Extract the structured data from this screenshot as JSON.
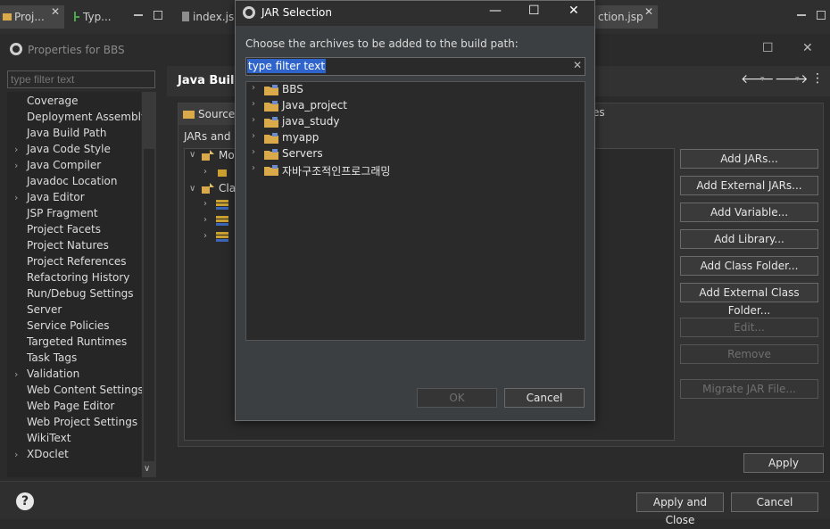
{
  "ide_tabs": {
    "tab1": "Proj...",
    "tab2": "Typ...",
    "tab3": "index.jsp",
    "tab4": "ction.jsp"
  },
  "properties": {
    "title": "Properties for BBS",
    "filter_placeholder": "type filter text",
    "tree_items": [
      {
        "label": "Coverage",
        "expandable": false
      },
      {
        "label": "Deployment Assembly",
        "expandable": false
      },
      {
        "label": "Java Build Path",
        "expandable": false
      },
      {
        "label": "Java Code Style",
        "expandable": true
      },
      {
        "label": "Java Compiler",
        "expandable": true
      },
      {
        "label": "Javadoc Location",
        "expandable": false
      },
      {
        "label": "Java Editor",
        "expandable": true
      },
      {
        "label": "JSP Fragment",
        "expandable": false
      },
      {
        "label": "Project Facets",
        "expandable": false
      },
      {
        "label": "Project Natures",
        "expandable": false
      },
      {
        "label": "Project References",
        "expandable": false
      },
      {
        "label": "Refactoring History",
        "expandable": false
      },
      {
        "label": "Run/Debug Settings",
        "expandable": false
      },
      {
        "label": "Server",
        "expandable": false
      },
      {
        "label": "Service Policies",
        "expandable": false
      },
      {
        "label": "Targeted Runtimes",
        "expandable": false
      },
      {
        "label": "Task Tags",
        "expandable": false
      },
      {
        "label": "Validation",
        "expandable": true
      },
      {
        "label": "Web Content Settings",
        "expandable": false
      },
      {
        "label": "Web Page Editor",
        "expandable": false
      },
      {
        "label": "Web Project Settings",
        "expandable": false
      },
      {
        "label": "WikiText",
        "expandable": false
      },
      {
        "label": "XDoclet",
        "expandable": true
      }
    ],
    "page_title": "Java Build",
    "source_tab": "Source",
    "libs_tab_fragment": "es",
    "jars_label": "JARs and c",
    "jars_tree": {
      "mod_label": "Mo",
      "class_label": "Cla"
    },
    "buttons": {
      "add_jars": "Add JARs...",
      "add_external_jars": "Add External JARs...",
      "add_variable": "Add Variable...",
      "add_library": "Add Library...",
      "add_class_folder": "Add Class Folder...",
      "add_external_class_folder": "Add External Class Folder...",
      "edit": "Edit...",
      "remove": "Remove",
      "migrate": "Migrate JAR File...",
      "apply": "Apply",
      "apply_and_close": "Apply and Close",
      "cancel": "Cancel"
    },
    "help": "?"
  },
  "jar_dialog": {
    "title": "JAR Selection",
    "message": "Choose the archives to be added to the build path:",
    "filter_text": "type filter text",
    "items": [
      {
        "label": "BBS"
      },
      {
        "label": "Java_project"
      },
      {
        "label": "java_study"
      },
      {
        "label": "myapp"
      },
      {
        "label": "Servers"
      },
      {
        "label": "자바구조적인프로그래밍"
      }
    ],
    "ok": "OK",
    "cancel": "Cancel"
  },
  "colors": {
    "selection": "#2f65ca",
    "folder": "#d9a94a"
  }
}
